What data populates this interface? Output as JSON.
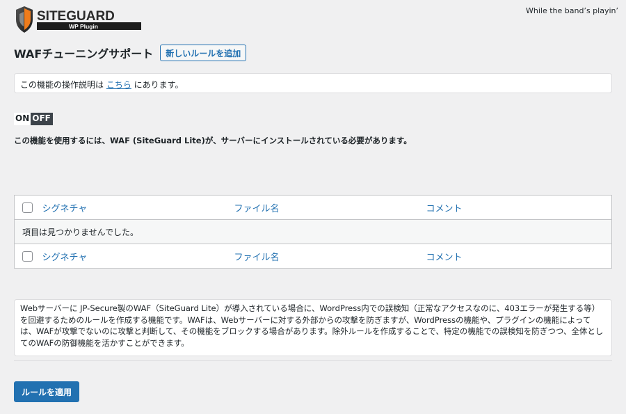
{
  "logo": {
    "brand": "SITEGUARD",
    "subtitle": "WP Plugin"
  },
  "header": {
    "greeting": "While the band’s playin’"
  },
  "page": {
    "title": "WAFチューニングサポート",
    "add_button": "新しいルールを追加"
  },
  "notice": {
    "prefix": "この機能の操作説明は ",
    "link": "こちら",
    "suffix": " にあります。"
  },
  "toggle": {
    "on": "ON",
    "off": "OFF"
  },
  "requirement": "この機能を使用するには、WAF (SiteGuard Lite)が、サーバーにインストールされている必要があります。",
  "table": {
    "columns": {
      "signature": "シグネチャ",
      "filename": "ファイル名",
      "comment": "コメント"
    },
    "empty": "項目は見つかりませんでした。"
  },
  "description": "Webサーバーに JP-Secure製のWAF（SiteGuard Lite）が導入されている場合に、WordPress内での誤検知（正常なアクセスなのに、403エラーが発生する等）を回避するためのルールを作成する機能です。WAFは、Webサーバーに対する外部からの攻撃を防ぎますが、WordPressの機能や、プラグインの機能によっては、WAFが攻撃でないのに攻撃と判断して、その機能をブロックする場合があります。除外ルールを作成することで、特定の機能での誤検知を防ぎつつ、全体としてのWAFの防御機能を活かすことができます。",
  "apply_button": "ルールを適用",
  "colors": {
    "accent": "#2271b1",
    "brand_orange": "#f07c1c",
    "background": "#f0f0f1"
  }
}
